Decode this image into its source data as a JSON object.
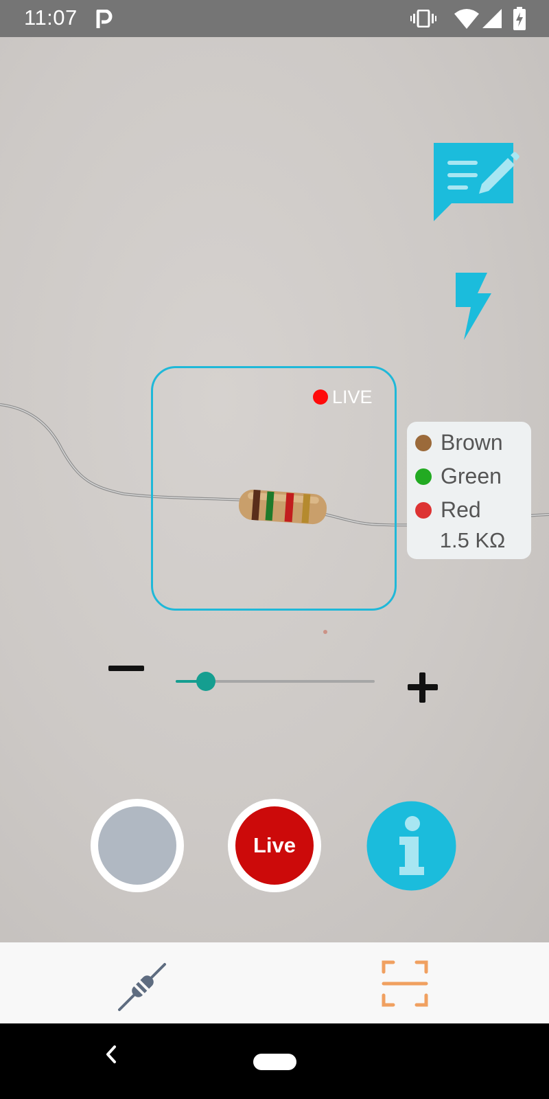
{
  "status_bar": {
    "time": "11:07",
    "notification_icon": "parking-p-icon",
    "icons": [
      "vibrate-icon",
      "wifi-icon",
      "cell-signal-icon",
      "battery-charging-icon"
    ]
  },
  "camera": {
    "live_indicator": {
      "label": "LIVE",
      "dot_color": "#ff0a0a"
    },
    "frame_color": "#1fb8d8"
  },
  "result": {
    "bands": [
      {
        "name": "Brown",
        "color": "#9b6a3a"
      },
      {
        "name": "Green",
        "color": "#22aa22"
      },
      {
        "name": "Red",
        "color": "#dd3333"
      }
    ],
    "value": "1.5 KΩ"
  },
  "zoom": {
    "level": 0.15,
    "accent": "#159e90"
  },
  "actions": {
    "gallery_color": "#b0b8c2",
    "live_label": "Live",
    "live_color": "#cc0a0a",
    "info_color": "#1bbcdc"
  },
  "tools": {
    "notes_icon": "comment-edit-icon",
    "flash_icon": "flash-icon",
    "accent": "#1bbcdc"
  },
  "bottom_nav": {
    "items": [
      {
        "icon": "resistor-icon",
        "active": false
      },
      {
        "icon": "scan-frame-icon",
        "active": true
      }
    ],
    "active_color": "#f0a060"
  }
}
